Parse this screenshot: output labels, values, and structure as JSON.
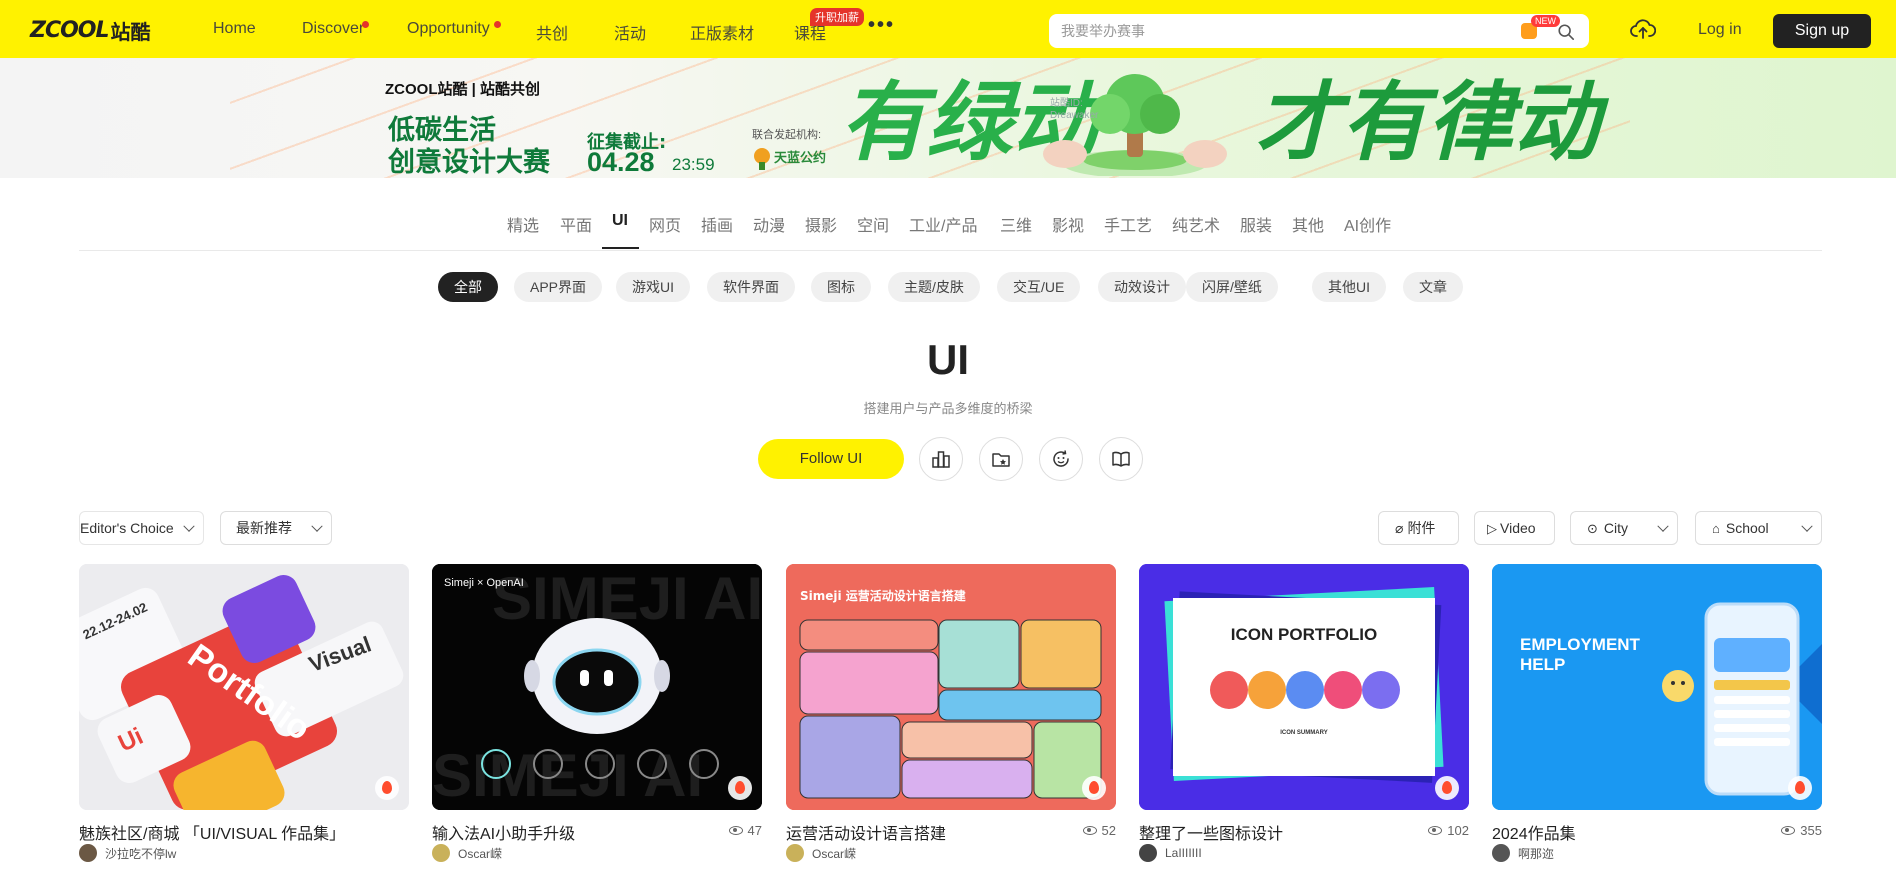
{
  "header": {
    "logo_en": "ZCOOL",
    "logo_cn": "站酷",
    "nav": [
      {
        "label": "Home",
        "dot": false
      },
      {
        "label": "Discover",
        "dot": true
      },
      {
        "label": "Opportunity",
        "dot": true
      },
      {
        "label": "共创",
        "dot": false
      },
      {
        "label": "活动",
        "dot": false
      },
      {
        "label": "正版素材",
        "dot": false
      },
      {
        "label": "课程",
        "dot": false
      }
    ],
    "course_badge": "升职加薪",
    "more_label": "•••",
    "search": {
      "placeholder": "我要举办赛事",
      "new_badge": "NEW"
    },
    "login_label": "Log in",
    "signup_label": "Sign up",
    "accent_color": "#fff200"
  },
  "banner": {
    "brand": "ZCOOL站酷 | 站酷共创",
    "title_line1": "低碳生活",
    "title_line2": "创意设计大赛",
    "deadline_label": "征集截止:",
    "deadline_date": "04.28",
    "deadline_time": "23:59",
    "organizer_label": "联合发起机构:",
    "organizer_name": "天蓝公约",
    "slogan_left": "有绿动",
    "slogan_right": "才有律动",
    "mini_text_1": "站酷ID:",
    "mini_text_2": "Dreawaker"
  },
  "categories": [
    "精选",
    "平面",
    "UI",
    "网页",
    "插画",
    "动漫",
    "摄影",
    "空间",
    "工业/产品",
    "三维",
    "影视",
    "手工艺",
    "纯艺术",
    "服装",
    "其他",
    "AI创作"
  ],
  "active_category": "UI",
  "sub_categories": [
    "全部",
    "APP界面",
    "游戏UI",
    "软件界面",
    "图标",
    "主题/皮肤",
    "交互/UE",
    "动效设计",
    "闪屏/壁纸",
    "其他UI",
    "文章"
  ],
  "active_sub_category": "全部",
  "section": {
    "title": "UI",
    "subtitle": "搭建用户与产品多维度的桥梁",
    "follow_label": "Follow UI"
  },
  "filters": {
    "editors_choice": "Editor's Choice",
    "sort": "最新推荐",
    "attachment": "附件",
    "video": "Video",
    "city": "City",
    "school": "School"
  },
  "cards": [
    {
      "title": "魅族社区/商城 「UI/VISUAL 作品集」",
      "views": "",
      "author": "沙拉吃不停lw"
    },
    {
      "title": "输入法AI小助手升级",
      "views": "47",
      "author": "Oscar嵘"
    },
    {
      "title": "运营活动设计语言搭建",
      "views": "52",
      "author": "Oscar嵘"
    },
    {
      "title": "整理了一些图标设计",
      "views": "102",
      "author": "LaIIIIIII"
    },
    {
      "title": "2024作品集",
      "views": "355",
      "author": "啊那迩"
    }
  ],
  "card_art_text": {
    "c1_date": "22.12-24.02",
    "c1_word1": "Portfolio",
    "c1_word2": "Visual",
    "c1_word3": "Ui",
    "c2_brand": "Simeji × OpenAI",
    "c2_watermark": "SIMEJI AI",
    "c3_title": "Simeji 运营活动设计语言搭建",
    "c4_title": "ICON PORTFOLIO",
    "c4_sub": "ICON SUMMARY",
    "c5_title_line1": "EMPLOYMENT",
    "c5_title_line2": "HELP"
  }
}
